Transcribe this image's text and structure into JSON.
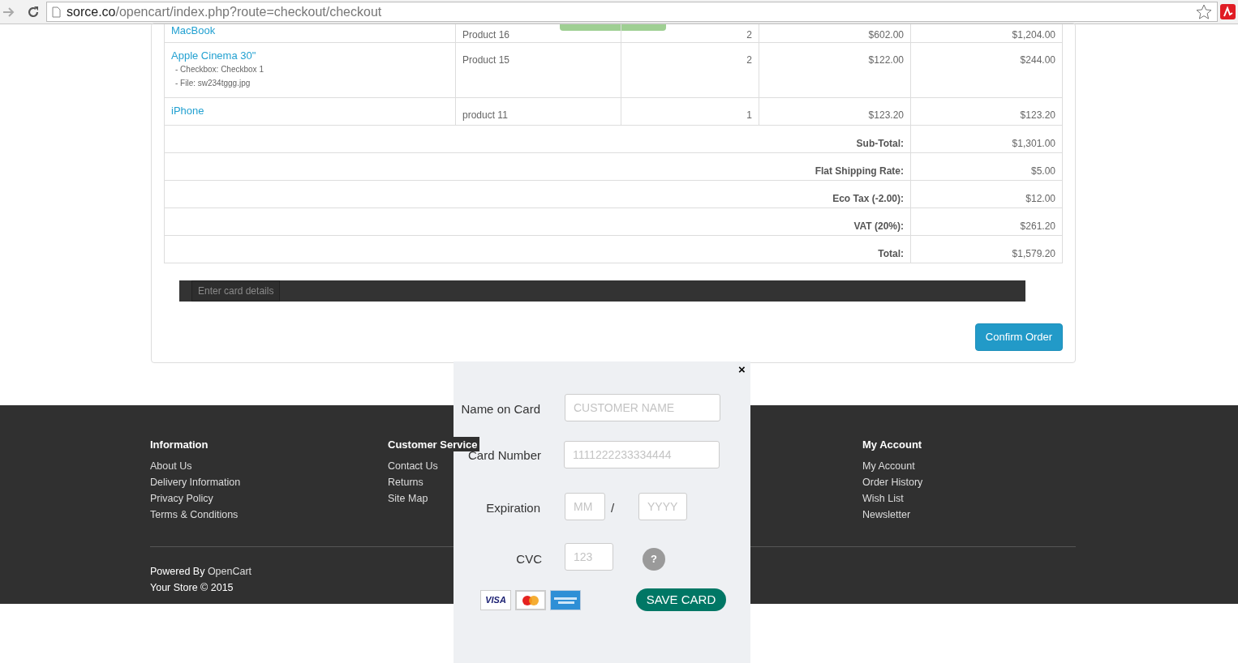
{
  "browser": {
    "url_host": "sorce.co",
    "url_path": "/opencart/index.php?route=checkout/checkout"
  },
  "order_table": {
    "rows": [
      {
        "name": "MacBook",
        "options": [],
        "model": "Product 16",
        "quantity": "2",
        "unit_price": "$602.00",
        "total": "$1,204.00"
      },
      {
        "name": "Apple Cinema 30\"",
        "options": [
          "- Checkbox: Checkbox 1",
          "- File: sw234tggg.jpg"
        ],
        "model": "Product 15",
        "quantity": "2",
        "unit_price": "$122.00",
        "total": "$244.00"
      },
      {
        "name": "iPhone",
        "options": [],
        "model": "product 11",
        "quantity": "1",
        "unit_price": "$123.20",
        "total": "$123.20"
      }
    ],
    "totals": [
      {
        "label": "Sub-Total:",
        "value": "$1,301.00"
      },
      {
        "label": "Flat Shipping Rate:",
        "value": "$5.00"
      },
      {
        "label": "Eco Tax (-2.00):",
        "value": "$12.00"
      },
      {
        "label": "VAT (20%):",
        "value": "$261.20"
      },
      {
        "label": "Total:",
        "value": "$1,579.20"
      }
    ]
  },
  "card_bar": {
    "button": "Enter card details"
  },
  "confirm_button": "Confirm Order",
  "footer": {
    "columns": [
      {
        "heading": "Information",
        "links": [
          "About Us",
          "Delivery Information",
          "Privacy Policy",
          "Terms & Conditions"
        ]
      },
      {
        "heading": "Customer Service",
        "links": [
          "Contact Us",
          "Returns",
          "Site Map"
        ]
      },
      {
        "heading": "My Account",
        "links": [
          "My Account",
          "Order History",
          "Wish List",
          "Newsletter"
        ]
      }
    ],
    "powered_prefix": "Powered By ",
    "powered_link": "OpenCart",
    "copyright": "Your Store © 2015"
  },
  "card_modal": {
    "close": "×",
    "name_label": "Name on Card",
    "name_placeholder": "CUSTOMER NAME",
    "number_label": "Card Number",
    "number_placeholder": "1111222233334444",
    "expiration_label": "Expiration",
    "month_placeholder": "MM",
    "separator": "/",
    "year_placeholder": "YYYY",
    "cvc_label": "CVC",
    "cvc_placeholder": "123",
    "help": "?",
    "card_brands": [
      {
        "kind": "visa",
        "label": "VISA"
      },
      {
        "kind": "mastercard"
      },
      {
        "kind": "amex"
      }
    ],
    "save_button": "SAVE CARD"
  }
}
